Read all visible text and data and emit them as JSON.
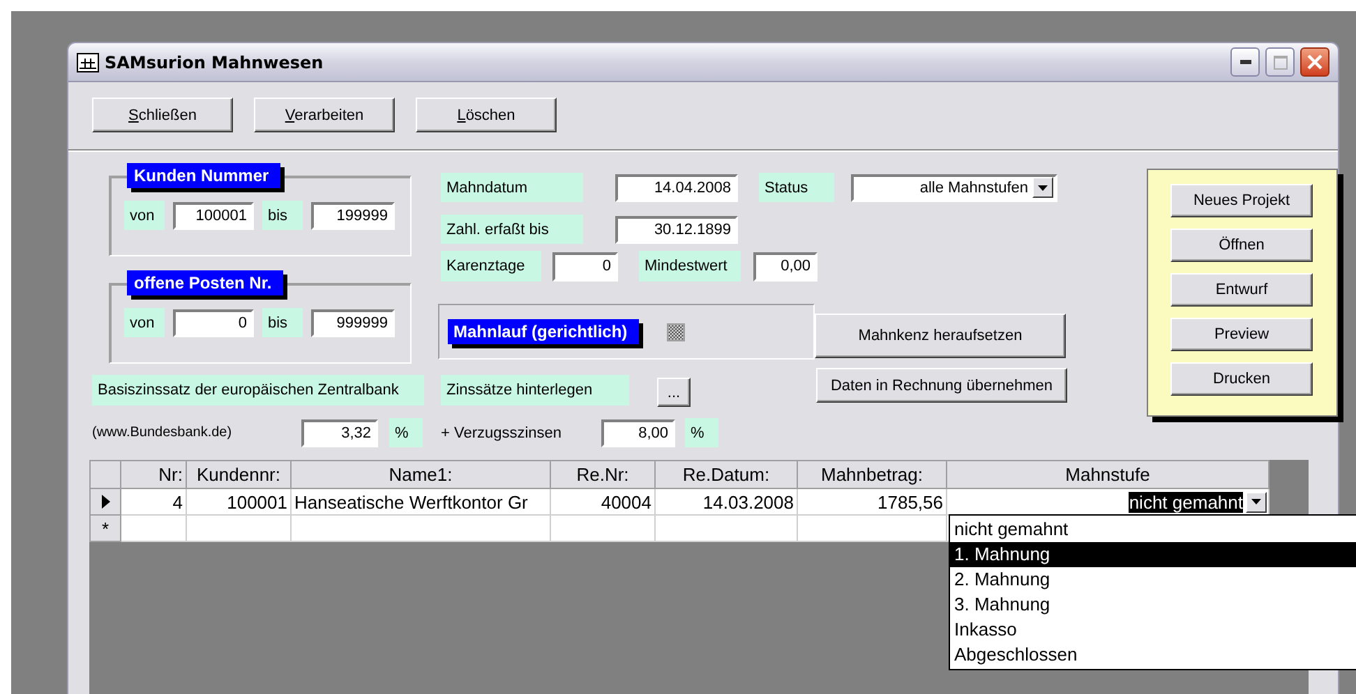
{
  "window": {
    "title": "SAMsurion Mahnwesen"
  },
  "toolbar": [
    {
      "label": "Schließen"
    },
    {
      "label": "Verarbeiten"
    },
    {
      "label": "Löschen"
    }
  ],
  "groups": [
    {
      "title": "Kunden Nummer",
      "from_label": "von",
      "from": "100001",
      "to_label": "bis",
      "to": "199999"
    },
    {
      "title": "offene Posten Nr.",
      "from_label": "von",
      "from": "0",
      "to_label": "bis",
      "to": "999999"
    }
  ],
  "mahndatum": {
    "label": "Mahndatum",
    "value": "14.04.2008"
  },
  "status": {
    "label": "Status",
    "value": "alle Mahnstufen"
  },
  "zahlung": {
    "label": "Zahl. erfaßt bis",
    "value": "30.12.1899"
  },
  "karenztage": {
    "label": "Karenztage",
    "value": "0"
  },
  "mindestwert": {
    "label": "Mindestwert",
    "value": "0,00"
  },
  "mahnlauf": {
    "title": "Mahnlauf (gerichtlich)",
    "checked": false,
    "indeterminate": true
  },
  "mahnkenz_button": "Mahnkenz heraufsetzen",
  "daten_button": "Daten in Rechnung übernehmen",
  "interest": {
    "base_label": "Basiszinssatz der europäischen Zentralbank",
    "rates_label": "Zinssätze hinterlegen",
    "rates_button": "...",
    "source": "(www.Bundesbank.de)",
    "base_value": "3,32",
    "base_unit": "%",
    "surcharge_label": "+ Verzugsszinsen",
    "surcharge_value": "8,00",
    "surcharge_unit": "%"
  },
  "project_buttons": [
    "Neues Projekt",
    "Öffnen",
    "Entwurf",
    "Preview",
    "Drucken"
  ],
  "table": {
    "columns": [
      "Nr:",
      "Kundennr:",
      "Name1:",
      "Re.Nr:",
      "Re.Datum:",
      "Mahnbetrag:",
      "Mahnstufe"
    ],
    "rows": [
      {
        "current": true,
        "cells": [
          "4",
          "100001",
          "Hanseatische Werftkontor Gr",
          "40004",
          "14.03.2008",
          "1785,56",
          "nicht gemahnt"
        ]
      }
    ],
    "new_row_marker": "*"
  },
  "dropdown": {
    "options": [
      {
        "label": "nicht gemahnt",
        "selected": false
      },
      {
        "label": "1. Mahnung",
        "selected": true
      },
      {
        "label": "2. Mahnung",
        "selected": false
      },
      {
        "label": "3. Mahnung",
        "selected": false
      },
      {
        "label": "Inkasso",
        "selected": false
      },
      {
        "label": "Abgeschlossen",
        "selected": false
      }
    ]
  }
}
